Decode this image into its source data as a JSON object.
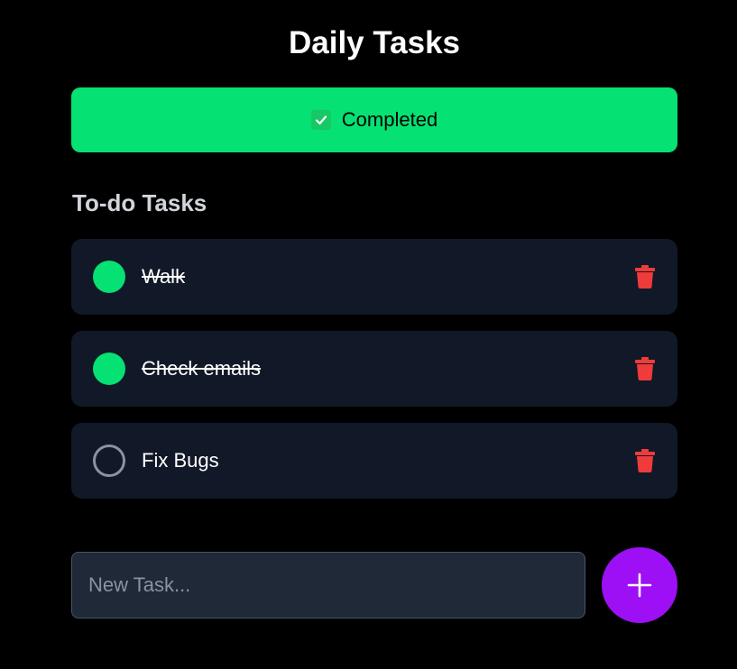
{
  "app": {
    "title": "Daily Tasks"
  },
  "completed_button": {
    "label": "Completed",
    "icon": "checkbox-checked-icon",
    "color": "#05e173"
  },
  "todo_section": {
    "title": "To-do Tasks",
    "tasks": [
      {
        "label": "Walk",
        "done": true,
        "delete_icon": "trash-icon"
      },
      {
        "label": "Check emails",
        "done": true,
        "delete_icon": "trash-icon"
      },
      {
        "label": "Fix Bugs",
        "done": false,
        "delete_icon": "trash-icon"
      }
    ]
  },
  "new_task": {
    "value": "",
    "placeholder": "New Task...",
    "add_icon": "plus-icon"
  },
  "colors": {
    "background": "#000000",
    "card": "#111827",
    "input": "#1f2937",
    "done": "#05e173",
    "delete": "#ef3b3b",
    "add_button": "#9d0ff5"
  }
}
